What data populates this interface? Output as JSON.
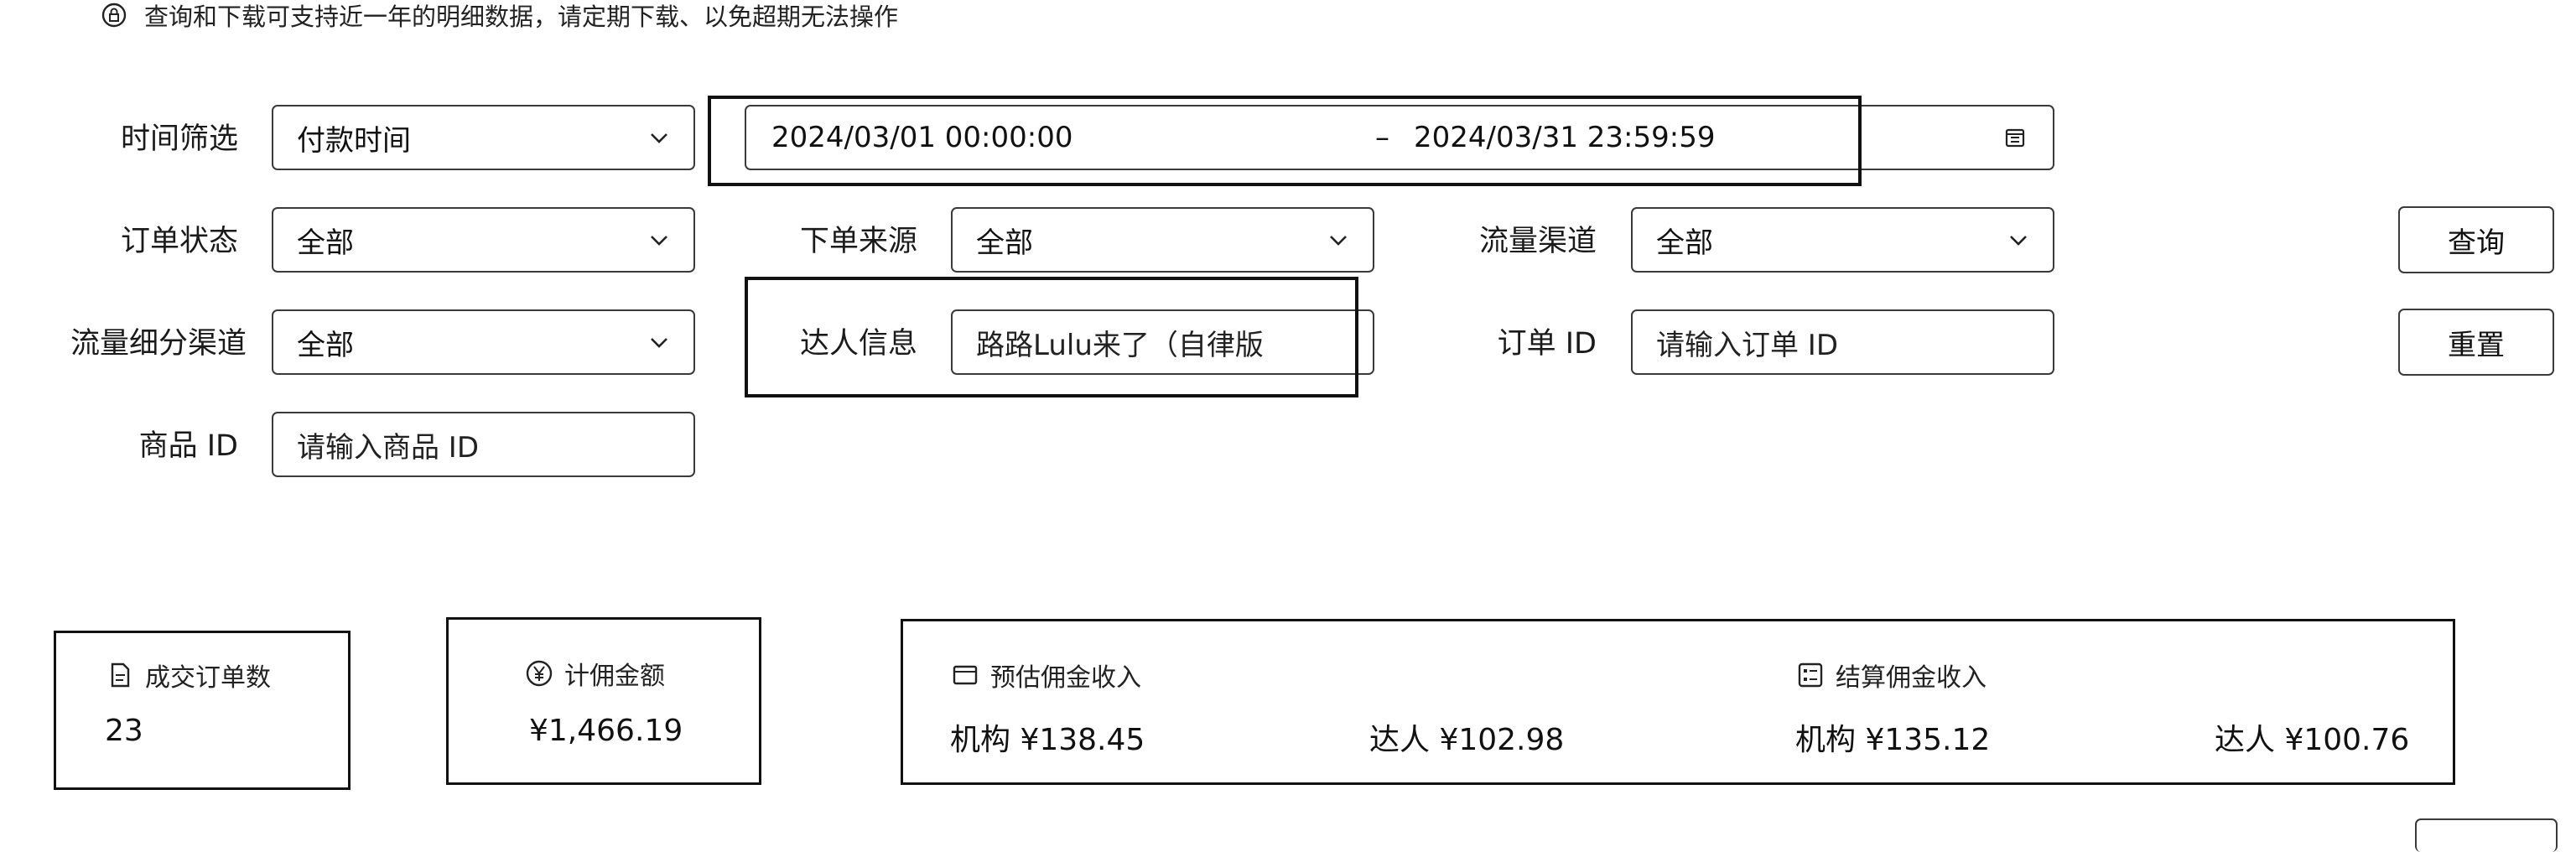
{
  "notice": {
    "text": "查询和下载可支持近一年的明细数据，请定期下载、以免超期无法操作"
  },
  "filters": {
    "time_label": "时间筛选",
    "time_type": "付款时间",
    "date_start": "2024/03/01 00:00:00",
    "date_sep": "–",
    "date_end": "2024/03/31 23:59:59",
    "order_status_label": "订单状态",
    "order_status_value": "全部",
    "order_source_label": "下单来源",
    "order_source_value": "全部",
    "traffic_channel_label": "流量渠道",
    "traffic_channel_value": "全部",
    "traffic_sub_label": "流量细分渠道",
    "traffic_sub_value": "全部",
    "influencer_label": "达人信息",
    "influencer_value": "路路Lulu来了（自律版",
    "order_id_label": "订单 ID",
    "order_id_placeholder": "请输入订单 ID",
    "product_id_label": "商品 ID",
    "product_id_placeholder": "请输入商品 ID"
  },
  "buttons": {
    "query": "查询",
    "reset": "重置"
  },
  "stats": {
    "orders": {
      "title": "成交订单数",
      "value": "23"
    },
    "commission_amount": {
      "title": "计佣金额",
      "value": "¥1,466.19"
    },
    "estimated": {
      "title": "预估佣金收入",
      "org": "机构 ¥138.45",
      "influencer": "达人 ¥102.98"
    },
    "settled": {
      "title": "结算佣金收入",
      "org": "机构 ¥135.12",
      "influencer": "达人 ¥100.76"
    }
  }
}
